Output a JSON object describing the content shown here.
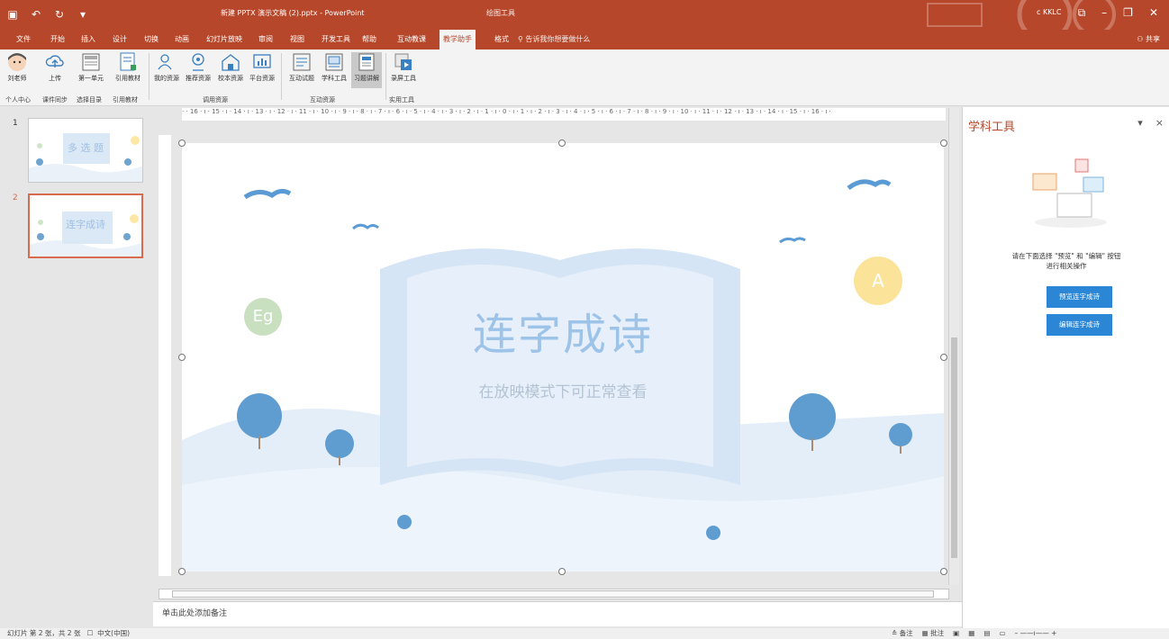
{
  "window": {
    "title": "新建 PPTX 演示文稿 (2).pptx - PowerPoint",
    "context_tab": "绘图工具",
    "user": "c KKLC",
    "share": "共享"
  },
  "tabs": [
    "文件",
    "开始",
    "插入",
    "设计",
    "切换",
    "动画",
    "幻灯片放映",
    "审阅",
    "视图",
    "开发工具",
    "帮助",
    "互动教课",
    "教学助手",
    "格式"
  ],
  "active_tab": "教学助手",
  "tell_me": "告诉我你想要做什么",
  "ribbon": {
    "buttons": [
      "刘老师",
      "上传",
      "第一单元",
      "引用教材",
      "我的资源",
      "推荐资源",
      "校本资源",
      "平台资源",
      "互动试题",
      "学科工具",
      "习题讲解",
      "录屏工具"
    ],
    "groups": [
      "个人中心",
      "课件同步",
      "选择目录",
      "引用教材",
      "调用资源",
      "互动资源",
      "实用工具"
    ]
  },
  "ruler": {
    "labels": "· · 16 · ı · 15 · ı · 14 · ı · 13 · ı · 12 · ı · 11 · ı · 10 · ı · 9 · ı · 8 · ı · 7 · ı · 6 · ı · 5 · ı · 4 · ı · 3 · ı · 2 · ı · 1 · ı · 0 · ı · 1 · ı · 2 · ı · 3 · ı · 4 · ı · 5 · ı · 6 · ı · 7 · ı · 8 · ı · 9 · ı · 10 · ı · 11 · ı · 12 · ı · 13 · ı · 14 · ı · 15 · ı · 16 · ı ·"
  },
  "thumbnails": [
    {
      "num": "1",
      "title": "多 选 题"
    },
    {
      "num": "2",
      "title": "连字成诗"
    }
  ],
  "slide": {
    "title": "连字成诗",
    "subtitle": "在放映模式下可正常查看",
    "badge_left": "Eg",
    "badge_right": "A"
  },
  "notes_placeholder": "单击此处添加备注",
  "pane": {
    "title": "学科工具",
    "dropdown": "▾",
    "close": "×",
    "info_line1": "请在下面选择 \"预览\" 和 \"编辑\" 按钮",
    "info_line2": "进行相关操作",
    "preview_button": "预览连字成诗",
    "edit_button": "编辑连字成诗"
  },
  "status": {
    "slide_info": "幻灯片 第 2 张，共 2 张",
    "language": "中文(中国)",
    "notes": "备注",
    "comments": "批注"
  },
  "colors": {
    "brand": "#b7472a",
    "accent_blue": "#2b87d6",
    "slide_title": "#9dc3e8"
  }
}
